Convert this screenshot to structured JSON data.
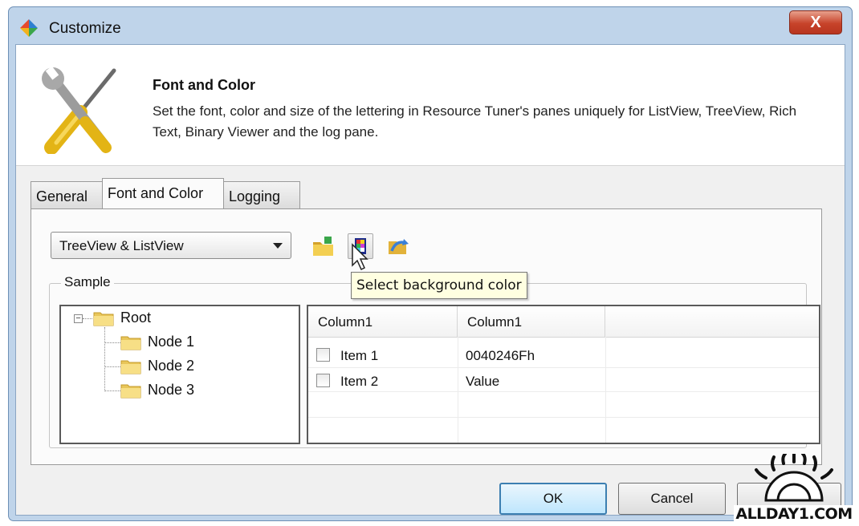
{
  "window": {
    "title": "Customize",
    "close_glyph": "X"
  },
  "header": {
    "title": "Font and Color",
    "description": "Set the font, color and size of the lettering in Resource Tuner's panes uniquely for ListView, TreeView, Rich Text, Binary Viewer and the log pane.",
    "icon": "tools-icon"
  },
  "tabs": [
    {
      "label": "General",
      "active": false
    },
    {
      "label": "Font and Color",
      "active": true
    },
    {
      "label": "Logging",
      "active": false
    }
  ],
  "toolbar": {
    "pane_select_value": "TreeView & ListView",
    "buttons": [
      {
        "icon": "select-font-icon"
      },
      {
        "icon": "select-background-color-icon"
      },
      {
        "icon": "reset-icon"
      }
    ],
    "tooltip": "Select background color"
  },
  "sample": {
    "label": "Sample",
    "tree": {
      "root": "Root",
      "nodes": [
        "Node 1",
        "Node 2",
        "Node 3"
      ]
    },
    "list": {
      "columns": [
        "Column1",
        "Column1"
      ],
      "rows": [
        {
          "name": "Item 1",
          "value": "0040246Fh"
        },
        {
          "name": "Item 2",
          "value": "Value"
        }
      ]
    }
  },
  "buttons": {
    "ok": "OK",
    "cancel": "Cancel"
  },
  "watermark": "ALLDAY1.COM",
  "colors": {
    "title_bar": "#bfd4ea",
    "close": "#c7432a",
    "tooltip_bg": "#ffffe1",
    "folder": "#f5d66b"
  }
}
